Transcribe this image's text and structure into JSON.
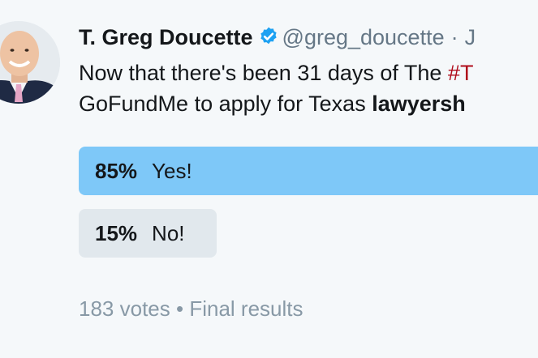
{
  "tweet": {
    "author_name": "T. Greg Doucette",
    "handle": "@greg_doucette",
    "separator": "·",
    "date_fragment": "J",
    "text_line1_prefix": "Now that there's been 31 days of The ",
    "text_line1_hashtag": "#T",
    "text_line2_prefix": "GoFundMe to apply for Texas ",
    "text_line2_bold": "lawyersh"
  },
  "poll": {
    "options": [
      {
        "percent": "85%",
        "label": "Yes!",
        "fraction": 0.85
      },
      {
        "percent": "15%",
        "label": "No!",
        "fraction": 0.15
      }
    ],
    "votes": "183 votes",
    "status_separator": "•",
    "status": "Final results"
  },
  "colors": {
    "winning_bar": "#7ec8f8",
    "losing_bar": "#e1e8ed",
    "verified_badge": "#1da1f2",
    "hashtag": "#b00c1b",
    "muted_text": "#8899a6"
  },
  "icons": {
    "verified": "verified-badge-icon"
  }
}
